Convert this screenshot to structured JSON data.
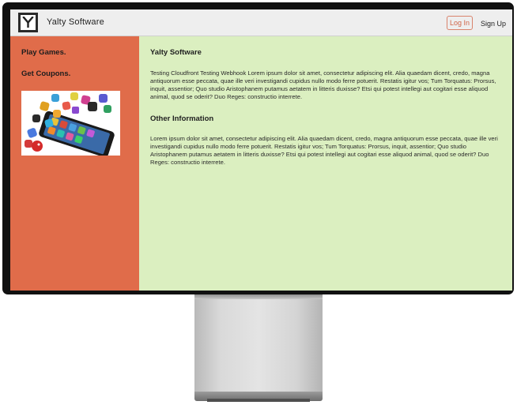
{
  "navbar": {
    "logo_letter": "Y",
    "brand": "Yalty Software",
    "login_label": "Log In",
    "signup_label": "Sign Up"
  },
  "sidebar": {
    "links": [
      "Play Games.",
      "Get Coupons."
    ],
    "promo_image": "app-icons-smartphone-image"
  },
  "main": {
    "sections": [
      {
        "heading": "Yalty Software",
        "body": "Testing Cloudfront Testing Webhook Lorem ipsum dolor sit amet, consectetur adipiscing elit. Alia quaedam dicent, credo, magna antiquorum esse peccata, quae ille veri investigandi cupidus nullo modo ferre potuerit. Restatis igitur vos; Tum Torquatus: Prorsus, inquit, assentior; Quo studio Aristophanem putamus aetatem in litteris duxisse? Etsi qui potest intellegi aut cogitari esse aliquod animal, quod se oderit? Duo Reges: constructio interrete."
      },
      {
        "heading": "Other Information",
        "body": "Lorem ipsum dolor sit amet, consectetur adipiscing elit. Alia quaedam dicent, credo, magna antiquorum esse peccata, quae ille veri investigandi cupidus nullo modo ferre potuerit. Restatis igitur vos; Tum Torquatus: Prorsus, inquit, assentior; Quo studio Aristophanem putamus aetatem in litteris duxisse? Etsi qui potest intellegi aut cogitari esse aliquod animal, quod se oderit? Duo Reges: constructio interrete."
      }
    ]
  },
  "colors": {
    "sidebar_bg": "#e06c4a",
    "main_bg": "#dbefc0",
    "navbar_bg": "#eeeeee",
    "login_border": "#d9836c"
  }
}
